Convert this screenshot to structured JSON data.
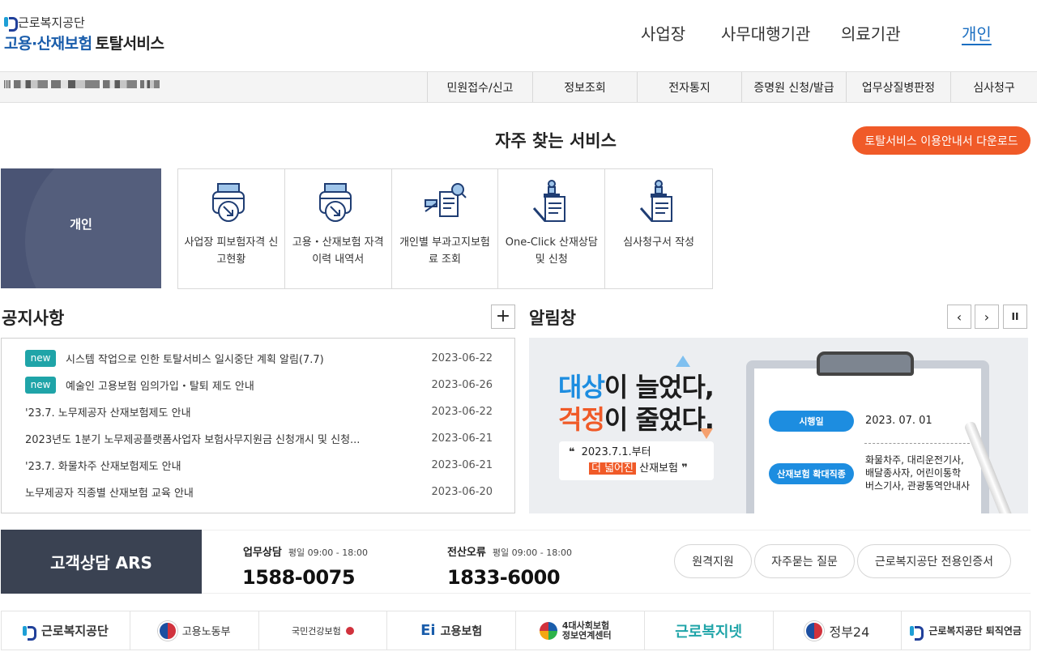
{
  "header": {
    "logo_org": "근로복지공단",
    "logo_service_blue": "고용·산재보험",
    "logo_service_dark": "토탈서비스",
    "nav": [
      "사업장",
      "사무대행기관",
      "의료기관",
      "개인"
    ],
    "active_nav": "개인"
  },
  "submenu": {
    "items": [
      "민원접수/신고",
      "정보조회",
      "전자통지",
      "증명원 신청/발급",
      "업무상질병판정",
      "심사청구"
    ]
  },
  "frequent": {
    "title": "자주 찾는 서비스",
    "download_label": "토탈서비스 이용안내서 다운로드",
    "personal_label": "개인",
    "services": [
      {
        "label": "사업장 피보험자격 신고현황",
        "icon": "document-tray-icon"
      },
      {
        "label": "고용・산재보험 자격 이력 내역서",
        "icon": "document-tray-icon"
      },
      {
        "label": "개인별 부과고지보험료 조회",
        "icon": "search-document-icon"
      },
      {
        "label": "One-Click 산재상담 및 신청",
        "icon": "stamp-document-icon"
      },
      {
        "label": "심사청구서 작성",
        "icon": "stamp-document-icon"
      }
    ]
  },
  "notice": {
    "title": "공지사항",
    "more_label": "+",
    "new_label": "new",
    "rows": [
      {
        "text": "시스템 작업으로 인한 토탈서비스 일시중단 계획 알림(7.7)",
        "date": "2023-06-22",
        "is_new": true
      },
      {
        "text": "예술인 고용보험 임의가입・탈퇴 제도 안내",
        "date": "2023-06-26",
        "is_new": true
      },
      {
        "text": "'23.7. 노무제공자 산재보험제도 안내",
        "date": "2023-06-22",
        "is_new": false
      },
      {
        "text": "2023년도 1분기 노무제공플랫폼사업자 보험사무지원금 신청개시 및 신청...",
        "date": "2023-06-21",
        "is_new": false
      },
      {
        "text": "'23.7. 화물차주 산재보험제도 안내",
        "date": "2023-06-21",
        "is_new": false
      },
      {
        "text": "노무제공자 직종별 산재보험 교육 안내",
        "date": "2023-06-20",
        "is_new": false
      }
    ]
  },
  "alert": {
    "title": "알림창",
    "prev_label": "‹",
    "next_label": "›",
    "pause_label": "II",
    "banner": {
      "line1_hl": "대상",
      "line1_rest": "이 늘었다,",
      "line2_hl": "걱정",
      "line2_rest": "이 줄었다.",
      "quote_line1": "2023.7.1.부터",
      "quote_hl": "더 넓어진",
      "quote_rest": "산재보험",
      "pill1": "시행일",
      "pill1_value": "2023. 07. 01",
      "pill2": "산재보험 확대직종",
      "pill2_value_1": "화물차주, 대리운전기사,",
      "pill2_value_2": "배달종사자, 어린이통학",
      "pill2_value_3": "버스기사, 관광통역안내사"
    }
  },
  "contact": {
    "ars_label": "고객상담 ARS",
    "business_label": "업무상담",
    "business_hours": "평일 09:00 - 18:00",
    "business_number": "1588-0075",
    "it_label": "전산오류",
    "it_hours": "평일 09:00 - 18:00",
    "it_number": "1833-6000",
    "buttons": [
      "원격지원",
      "자주묻는 질문",
      "근로복지공단 전용인증서"
    ]
  },
  "footer_logos": [
    "근로복지공단",
    "고용노동부",
    "국민건강보험",
    "고용보험",
    "4대사회보험 정보연계센터",
    "근로복지넷",
    "정부24",
    "근로복지공단 퇴직연금"
  ],
  "colors": {
    "accent_orange": "#f05a28",
    "teal_badge": "#1fa4a8",
    "nav_active": "#1a6ec1",
    "personal_box": "#4a5474"
  }
}
